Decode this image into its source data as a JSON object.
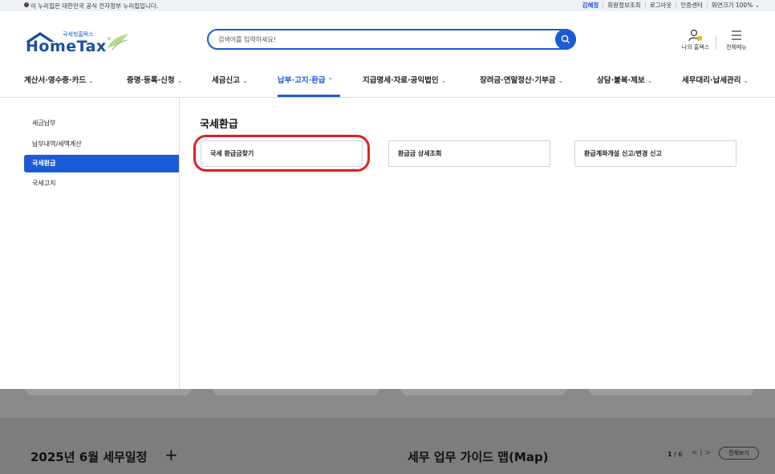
{
  "topbar": {
    "gov_notice": "이 누리집은 대한민국 공식 전자정부 누리집입니다.",
    "links": [
      "김혜정",
      "회원정보조회",
      "로그아웃",
      "인증센터",
      "화면크기 100% ⌄"
    ]
  },
  "header": {
    "logo_sub": "국세청홈택스",
    "logo_main": "HomeTax",
    "search_placeholder": "검색어를 입력하세요!",
    "my_hometax": "나의 홈택스",
    "all_menu": "전체메뉴"
  },
  "gnb": {
    "items": [
      {
        "label": "계산서·영수증·카드",
        "chev": "⌄"
      },
      {
        "label": "증명·등록·신청",
        "chev": "⌄"
      },
      {
        "label": "세금신고",
        "chev": "⌄"
      },
      {
        "label": "납부·고지·환급",
        "chev": "⌃"
      },
      {
        "label": "지급명세·자료·공익법인",
        "chev": "⌄"
      },
      {
        "label": "장려금·연말정산·기부금",
        "chev": "⌄"
      },
      {
        "label": "상담·불복·제보",
        "chev": "⌄"
      },
      {
        "label": "세무대리·납세관리",
        "chev": "⌄"
      }
    ],
    "active_index": 3
  },
  "sidebar": {
    "items": [
      {
        "label": "세금납부"
      },
      {
        "label": "납부내역/세액계산"
      },
      {
        "label": "국세환급"
      },
      {
        "label": "국세고지"
      }
    ],
    "active_index": 2
  },
  "content": {
    "title": "국세환급",
    "buttons": [
      {
        "label": "국세 환급금찾기"
      },
      {
        "label": "환급금 상세조회"
      },
      {
        "label": "환급계좌개설 신고/변경 신고"
      }
    ]
  },
  "background": {
    "schedule_title": "2025년 6월 세무일정",
    "plus": "+",
    "guide_title": "세무 업무 가이드 맵(Map)",
    "page_current": "1",
    "page_total": "/ 6",
    "prev": "<",
    "next": ">",
    "view_all": "전체보기"
  },
  "colors": {
    "accent": "#1c5bd8",
    "highlight": "#e0201e",
    "dim": "#8a8a8a"
  }
}
